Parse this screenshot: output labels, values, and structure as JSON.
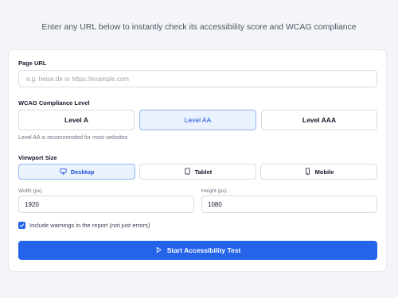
{
  "header": {
    "subtitle": "Enter any URL below to instantly check its accessibility score and WCAG compliance"
  },
  "form": {
    "url": {
      "label": "Page URL",
      "placeholder": "e.g. heise.de or https://example.com",
      "value": ""
    },
    "wcag": {
      "label": "WCAG Compliance Level",
      "options": [
        "Level A",
        "Level AA",
        "Level AAA"
      ],
      "selected": "Level AA",
      "hint": "Level AA is recommended for most websites"
    },
    "viewport": {
      "label": "Viewport Size",
      "options": [
        {
          "label": "Desktop",
          "icon": "monitor-icon"
        },
        {
          "label": "Tablet",
          "icon": "tablet-icon"
        },
        {
          "label": "Mobile",
          "icon": "smartphone-icon"
        }
      ],
      "selected": "Desktop",
      "width_label": "Width (px)",
      "width_value": "1920",
      "height_label": "Height (px)",
      "height_value": "1080"
    },
    "warnings": {
      "checked": true,
      "label": "Include warnings in the report (not just errors)"
    },
    "start_button": {
      "label": "Start Accessibility Test",
      "icon": "play-icon"
    }
  },
  "colors": {
    "accent": "#2563eb",
    "selected_bg": "#eaf2fe",
    "selected_border": "#93b8f3"
  }
}
